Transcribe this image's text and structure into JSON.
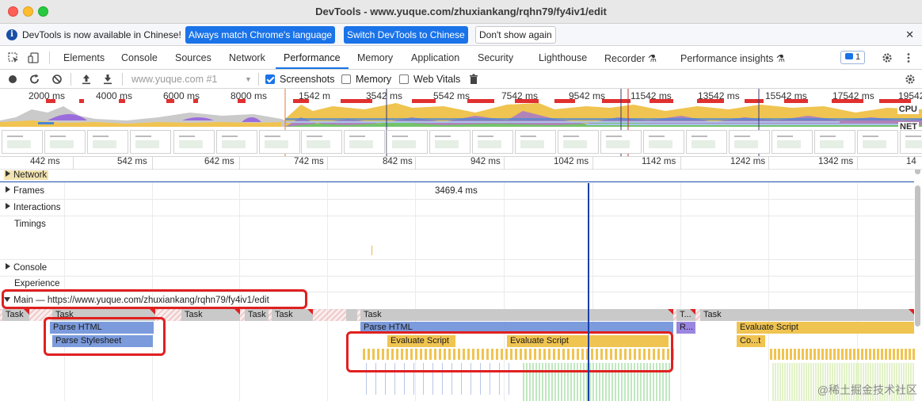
{
  "window": {
    "title": "DevTools - www.yuque.com/zhuxiankang/rqhn79/fy4iv1/edit"
  },
  "infobar": {
    "message": "DevTools is now available in Chinese!",
    "btn_match": "Always match Chrome's language",
    "btn_switch": "Switch DevTools to Chinese",
    "btn_dont_show": "Don't show again",
    "close": "✕"
  },
  "tabs": {
    "items": [
      "Elements",
      "Console",
      "Sources",
      "Network",
      "Performance",
      "Memory",
      "Application",
      "Security",
      "Lighthouse",
      "Recorder ⚗",
      "Performance insights ⚗"
    ],
    "active": "Performance",
    "issues_count": "1"
  },
  "controls": {
    "url": "www.yuque.com #1",
    "screenshots": "Screenshots",
    "memory": "Memory",
    "web_vitals": "Web Vitals"
  },
  "overview": {
    "ticks": [
      "2000 ms",
      "4000 ms",
      "6000 ms",
      "8000 ms",
      "1542 m",
      "3542 ms",
      "5542 ms",
      "7542 ms",
      "9542 ms",
      "11542 ms",
      "13542 ms",
      "15542 ms",
      "17542 ms",
      "19542"
    ],
    "cpu_label": "CPU",
    "net_label": "NET",
    "colors": {
      "scripting": "#f0c451",
      "rendering": "#9b6ddc",
      "painting": "#74c36b",
      "system": "#bdbdbd"
    }
  },
  "ruler": {
    "ticks": [
      "442 ms",
      "542 ms",
      "642 ms",
      "742 ms",
      "842 ms",
      "942 ms",
      "1042 ms",
      "1142 ms",
      "1242 ms",
      "1342 ms",
      "14"
    ]
  },
  "tracks": {
    "network": "Network",
    "frames": "Frames",
    "frames_value": "3469.4 ms",
    "interactions": "Interactions",
    "timings": "Timings",
    "console": "Console",
    "experience": "Experience",
    "main": "Main — https://www.yuque.com/zhuxiankang/rqhn79/fy4iv1/edit"
  },
  "flame": {
    "task": "Task",
    "task_short": "T...",
    "parse_html": "Parse HTML",
    "parse_stylesheet": "Parse Stylesheet",
    "evaluate_script": "Evaluate Script",
    "r_short": "R...",
    "co_t": "Co...t"
  },
  "watermark": "@稀土掘金技术社区"
}
